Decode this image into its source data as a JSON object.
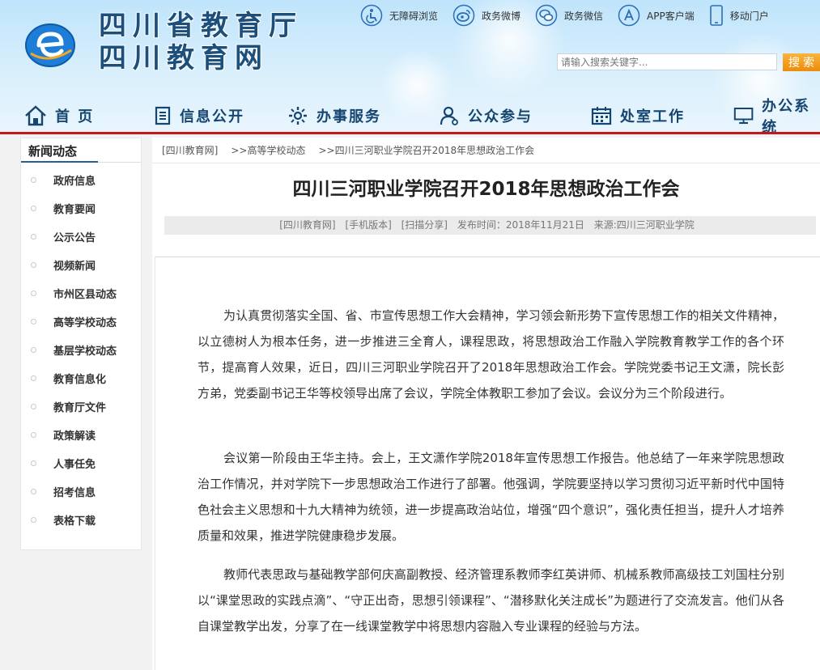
{
  "header": {
    "logo_line1": "四川省教育厅",
    "logo_line2": "四川教育网"
  },
  "toplinks": [
    {
      "label": "无障碍浏览",
      "icon": "accessibility-icon"
    },
    {
      "label": "政务微博",
      "icon": "weibo-icon"
    },
    {
      "label": "政务微信",
      "icon": "wechat-icon"
    },
    {
      "label": "APP客户端",
      "icon": "app-store-icon"
    },
    {
      "label": "移动门户",
      "icon": "mobile-icon"
    }
  ],
  "search": {
    "placeholder": "请输入搜索关键字...",
    "button": "搜索"
  },
  "nav": [
    {
      "label": "首 页",
      "icon": "home-icon"
    },
    {
      "label": "信息公开",
      "icon": "document-icon"
    },
    {
      "label": "办事服务",
      "icon": "service-icon"
    },
    {
      "label": "公众参与",
      "icon": "user-icon"
    },
    {
      "label": "处室工作",
      "icon": "calendar-icon"
    },
    {
      "label": "办公系统",
      "icon": "monitor-icon"
    }
  ],
  "sidebar": {
    "title": "新闻动态",
    "items": [
      "政府信息",
      "教育要闻",
      "公示公告",
      "视频新闻",
      "市州区县动态",
      "高等学校动态",
      "基层学校动态",
      "教育信息化",
      "教育厅文件",
      "政策解读",
      "人事任免",
      "招考信息",
      "表格下载"
    ]
  },
  "breadcrumb": [
    "[四川教育网]",
    ">>高等学校动态",
    ">>四川三河职业学院召开2018年思想政治工作会"
  ],
  "article": {
    "title": "四川三河职业学院召开2018年思想政治工作会",
    "meta": {
      "site": "[四川教育网]",
      "mobile": "[手机版本]",
      "share": "[扫描分享]",
      "published": "发布时间：2018年11月21日",
      "source": "来源:四川三河职业学院"
    },
    "paragraphs": [
      "为认真贯彻落实全国、省、市宣传思想工作大会精神，学习领会新形势下宣传思想工作的相关文件精神，以立德树人为根本任务，进一步推进三全育人，课程思政，将思想政治工作融入学院教育教学工作的各个环节，提高育人效果，近日，四川三河职业学院召开了2018年思想政治工作会。学院党委书记王文潇，院长彭方弟，党委副书记王华等校领导出席了会议，学院全体教职工参加了会议。会议分为三个阶段进行。",
      "会议第一阶段由王华主持。会上，王文潇作学院2018年宣传思想工作报告。他总结了一年来学院思想政治工作情况，并对学院下一步思想政治工作进行了部署。他强调，学院要坚持以学习贯彻习近平新时代中国特色社会主义思想和十九大精神为统领，进一步提高政治站位，增强“四个意识”，强化责任担当，提升人才培养质量和效果，推进学院健康稳步发展。",
      "教师代表思政与基础教学部何庆高副教授、经济管理系教师李红英讲师、机械系教师高级技工刘国柱分别以“课堂思政的实践点滴”、“守正出奇，思想引领课程”、“潜移默化关注成长”为题进行了交流发言。他们从各自课堂教学出发，分享了在一线课堂教学中将思想内容融入专业课程的经验与方法。"
    ]
  }
}
